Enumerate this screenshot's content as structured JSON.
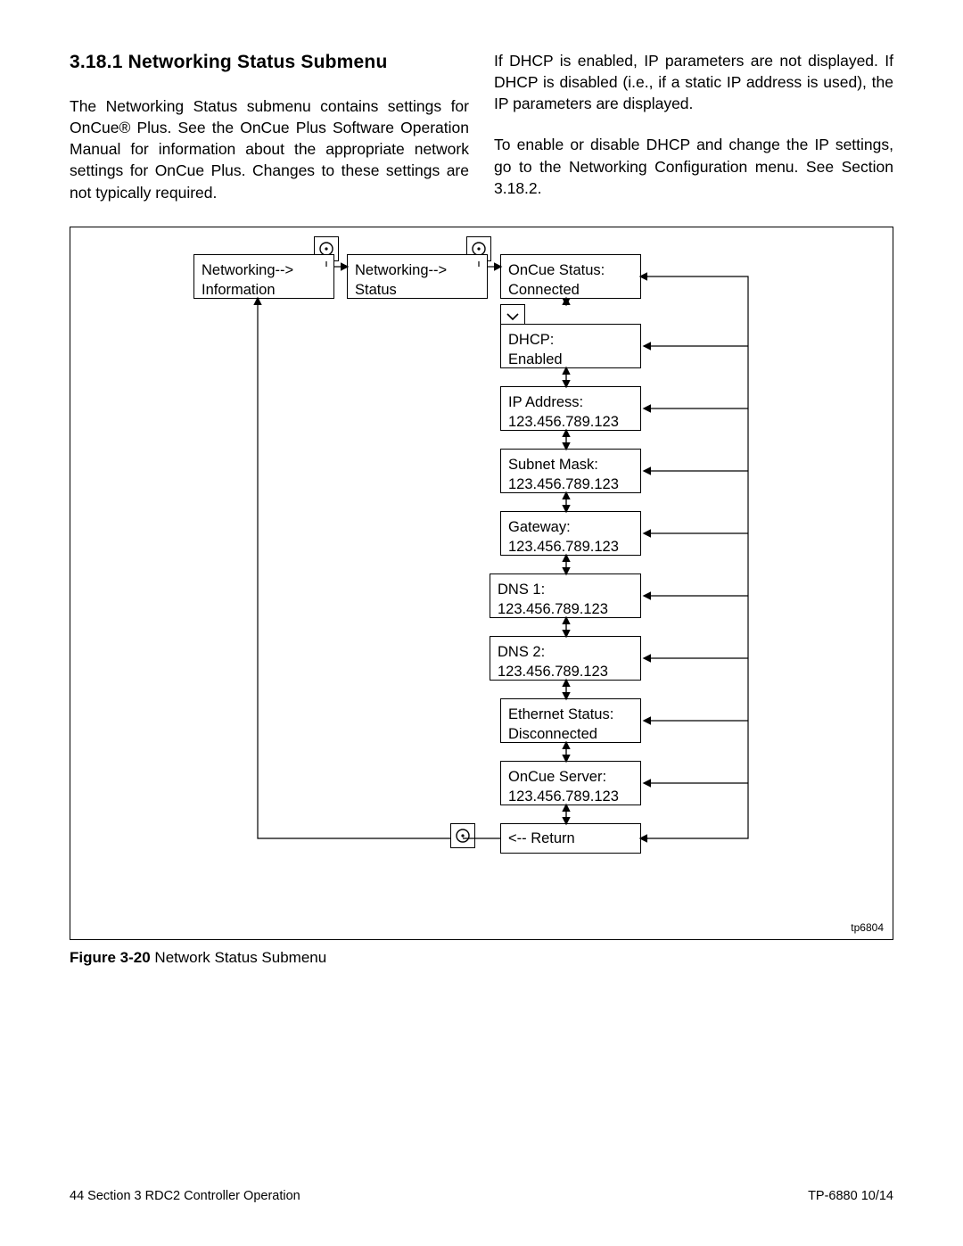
{
  "heading": "3.18.1   Networking Status Submenu",
  "para_left": "The Networking Status submenu contains settings for OnCue® Plus. See the OnCue Plus Software Operation Manual for information about the appropriate network settings for OnCue Plus. Changes to these settings are not typically required.",
  "para_r1": "If DHCP is enabled, IP parameters are not displayed. If DHCP is disabled (i.e., if a static IP address is used), the IP parameters are displayed.",
  "para_r2": "To enable or disable DHCP and change the IP settings, go to the Networking Configuration menu. See Section 3.18.2.",
  "fig_caption_label": "Figure 3-20",
  "fig_caption_text": " Network Status Submenu",
  "tp_small": "tp6804",
  "footer_left": "44    Section 3  RDC2 Controller Operation",
  "footer_right": "TP-6880   10/14",
  "boxes": {
    "info_l1": "Networking-->",
    "info_l2": "Information",
    "status_l1": "Networking-->",
    "status_l2": "Status",
    "oncue_l1": "OnCue Status:",
    "oncue_l2": "Connected",
    "dhcp_l1": "DHCP:",
    "dhcp_l2": "Enabled",
    "ip_l1": "IP Address:",
    "ip_l2": "123.456.789.123",
    "subnet_l1": "Subnet Mask:",
    "subnet_l2": "123.456.789.123",
    "gw_l1": "Gateway:",
    "gw_l2": "123.456.789.123",
    "dns1_l1": "DNS 1:",
    "dns1_l2": "123.456.789.123",
    "dns2_l1": "DNS 2:",
    "dns2_l2": "123.456.789.123",
    "eth_l1": "Ethernet Status:",
    "eth_l2": "Disconnected",
    "srv_l1": "OnCue Server:",
    "srv_l2": "123.456.789.123",
    "return": "<-- Return"
  }
}
